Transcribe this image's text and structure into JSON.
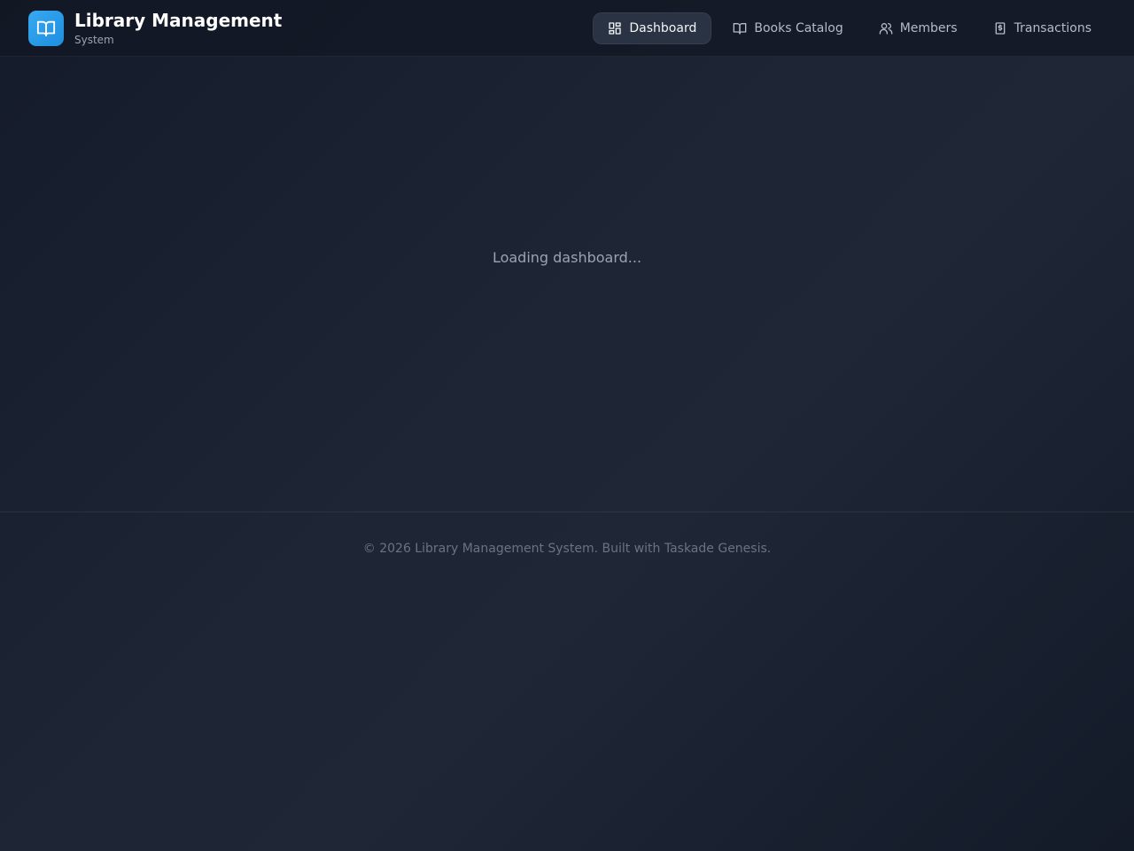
{
  "brand": {
    "title": "Library Management",
    "subtitle": "System",
    "logo_icon": "book-open-icon",
    "accent": "#2196f3"
  },
  "nav": {
    "items": [
      {
        "label": "Dashboard",
        "icon": "layout-dashboard-icon",
        "active": true
      },
      {
        "label": "Books Catalog",
        "icon": "book-open-icon",
        "active": false
      },
      {
        "label": "Members",
        "icon": "users-icon",
        "active": false
      },
      {
        "label": "Transactions",
        "icon": "receipt-icon",
        "active": false
      }
    ]
  },
  "main": {
    "loading_text": "Loading dashboard..."
  },
  "footer": {
    "text": "© 2026 Library Management System. Built with Taskade Genesis."
  }
}
